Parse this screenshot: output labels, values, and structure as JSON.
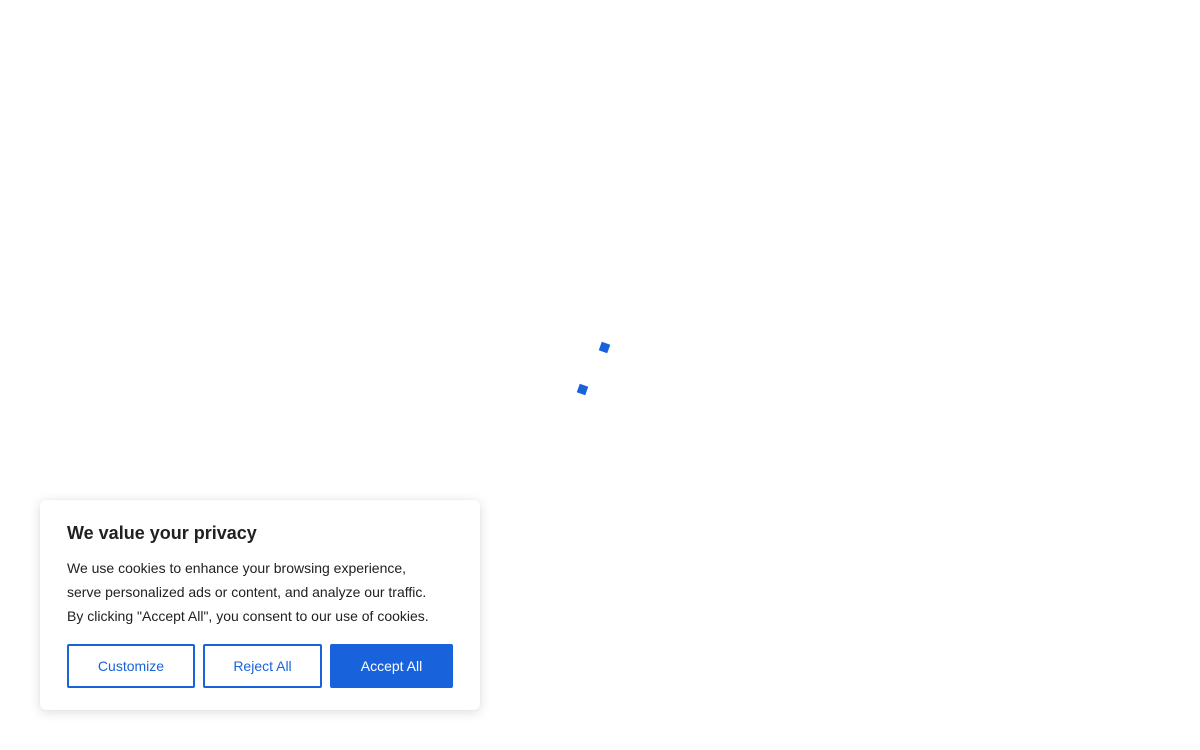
{
  "loader": {
    "label": "",
    "color": "#1863dc"
  },
  "consent": {
    "title": "We value your privacy",
    "text_line1": "We use cookies to enhance your browsing experience,",
    "text_line2": "serve personalized ads or content, and analyze our traffic.",
    "text_line3": "By clicking \"Accept All\", you consent to our use of cookies.",
    "buttons": {
      "customize": "Customize",
      "reject": "Reject All",
      "accept": "Accept All"
    },
    "accent_color": "#1863dc"
  }
}
